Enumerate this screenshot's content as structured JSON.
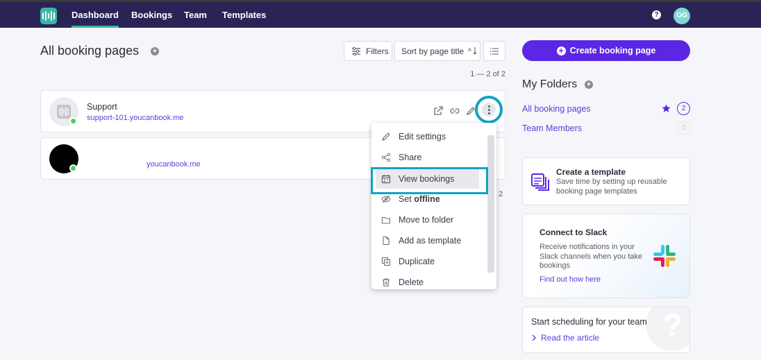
{
  "nav": {
    "items": [
      "Dashboard",
      "Bookings",
      "Team",
      "Templates"
    ],
    "active": "Dashboard",
    "help_icon": "help-icon",
    "avatar_initials": "OG"
  },
  "main": {
    "title": "All booking pages",
    "filters_label": "Filters",
    "sort_label": "Sort by page title",
    "pagination": "1 — 2 of 2",
    "pages": [
      {
        "name": "Support",
        "url": "support-101.youcanbook.me",
        "status": "online"
      },
      {
        "name": "",
        "url": "youcanbook.me",
        "status": "online"
      }
    ]
  },
  "menu": {
    "items": [
      {
        "label": "Edit settings",
        "icon": "pencil-icon"
      },
      {
        "label": "Share",
        "icon": "share-icon"
      },
      {
        "label": "View bookings",
        "icon": "calendar-icon",
        "highlighted": true
      },
      {
        "label_prefix": "Set ",
        "label_bold": "offline",
        "icon": "eye-off-icon"
      },
      {
        "label": "Move to folder",
        "icon": "folder-icon"
      },
      {
        "label": "Add as template",
        "icon": "file-icon"
      },
      {
        "label": "Duplicate",
        "icon": "duplicate-icon"
      },
      {
        "label": "Delete",
        "icon": "trash-icon"
      }
    ],
    "partial_pagination": "f 2"
  },
  "sidebar": {
    "create_button": "Create booking page",
    "folders_title": "My Folders",
    "folders": [
      {
        "label": "All booking pages",
        "count": "2",
        "starred": true
      },
      {
        "label": "Team Members",
        "count": "0",
        "starred": false
      }
    ],
    "template_card": {
      "title": "Create a template",
      "text": "Save time by setting up reusable booking page templates"
    },
    "slack_card": {
      "title": "Connect to Slack",
      "text": "Receive notifications in your Slack channels when you take bookings",
      "link": "Find out how here"
    },
    "article_card": {
      "title": "Start scheduling for your team",
      "link": "Read the article"
    }
  },
  "colors": {
    "topbar": "#2a2456",
    "accent": "#5b26e4",
    "teal": "#3cb5a4",
    "highlight": "#10a2c4"
  }
}
